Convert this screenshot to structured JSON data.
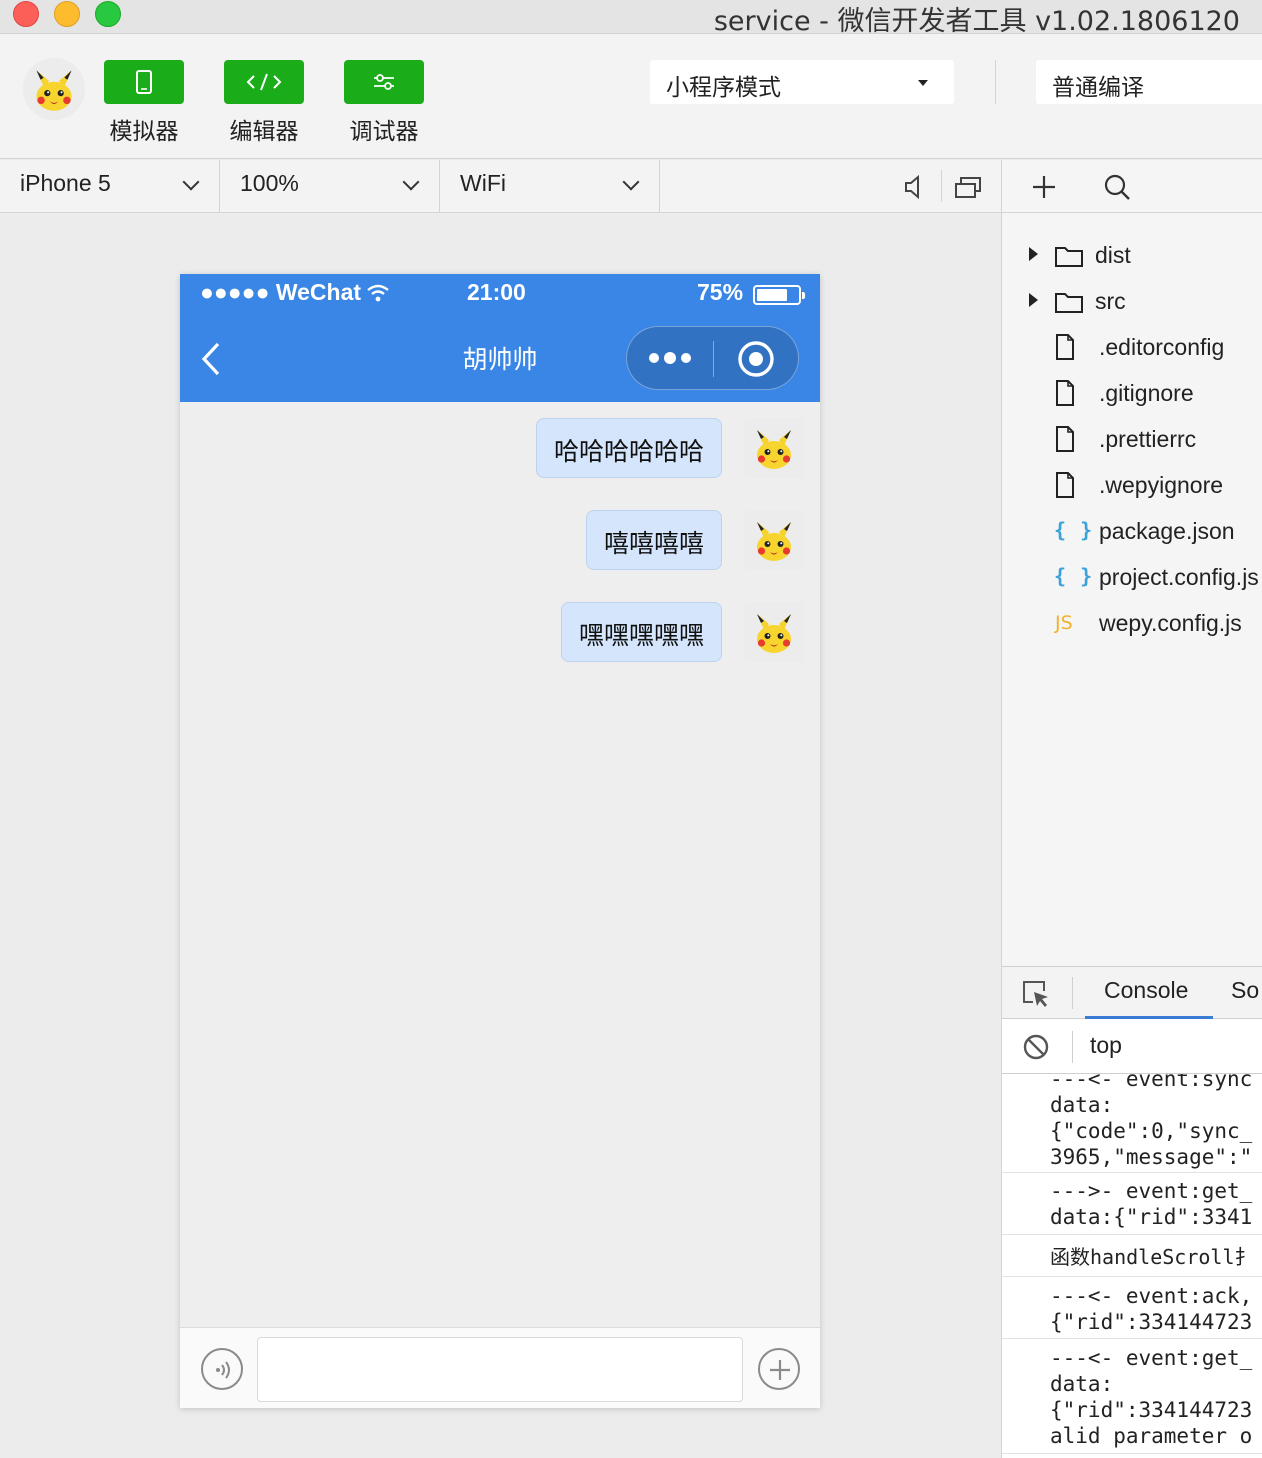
{
  "window": {
    "title": "service - 微信开发者工具 v1.02.1806120"
  },
  "toolbar": {
    "buttons": [
      {
        "label": "模拟器",
        "icon": "phone-icon"
      },
      {
        "label": "编辑器",
        "icon": "code-icon"
      },
      {
        "label": "调试器",
        "icon": "sliders-icon"
      }
    ],
    "mode_select": "小程序模式",
    "compile_select": "普通编译"
  },
  "device_bar": {
    "device": "iPhone 5",
    "zoom": "100%",
    "network": "WiFi"
  },
  "file_tree": [
    {
      "name": "dist",
      "type": "folder"
    },
    {
      "name": "src",
      "type": "folder"
    },
    {
      "name": ".editorconfig",
      "type": "file"
    },
    {
      "name": ".gitignore",
      "type": "file"
    },
    {
      "name": ".prettierrc",
      "type": "file"
    },
    {
      "name": ".wepyignore",
      "type": "file"
    },
    {
      "name": "package.json",
      "type": "json"
    },
    {
      "name": "project.config.js",
      "type": "json"
    },
    {
      "name": "wepy.config.js",
      "type": "js"
    }
  ],
  "file_icons": {
    "json": "{ }",
    "js": "JS"
  },
  "devtools": {
    "tabs": [
      "Console",
      "So"
    ],
    "active_tab": "Console",
    "context": "top",
    "logs": [
      "---<- event:sync\ndata:\n{\"code\":0,\"sync_\n3965,\"message\":\"",
      "--->- event:get_\ndata:{\"rid\":3341",
      "函数handleScroll扌",
      "---<- event:ack,\n{\"rid\":334144723",
      "---<- event:get_\ndata:\n{\"rid\":334144723\nalid parameter o"
    ]
  },
  "phone": {
    "status": {
      "carrier": "●●●●● WeChat",
      "time": "21:00",
      "battery": "75%",
      "battery_level": 0.75
    },
    "nav_title": "胡帅帅",
    "messages": [
      {
        "text": "哈哈哈哈哈哈"
      },
      {
        "text": "嘻嘻嘻嘻"
      },
      {
        "text": "嘿嘿嘿嘿嘿"
      }
    ],
    "input_value": ""
  },
  "colors": {
    "accent_green": "#1aad19",
    "wechat_blue": "#3a86e6",
    "bubble": "#d4e5fc",
    "console_tab": "#3a7bd5"
  }
}
